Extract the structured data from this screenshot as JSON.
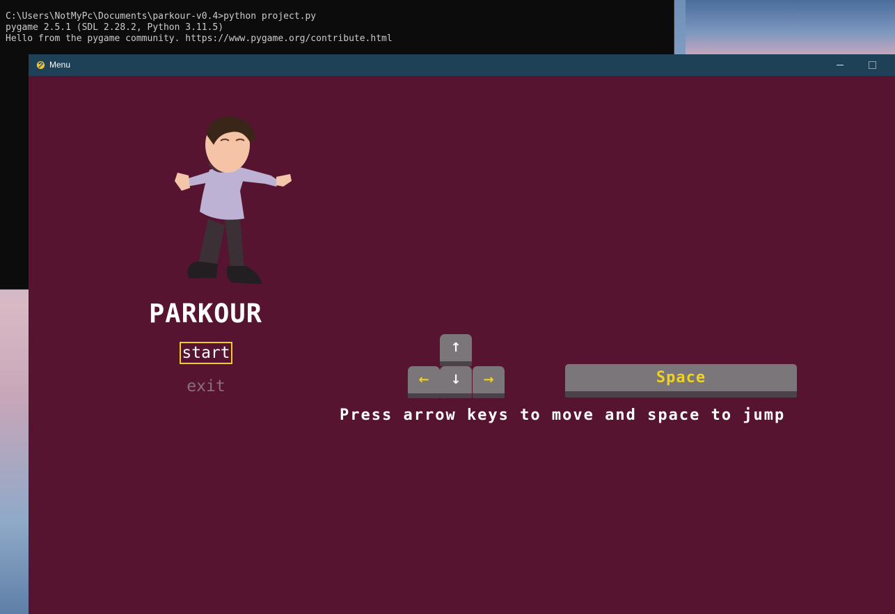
{
  "terminal": {
    "lines": [
      "C:\\Users\\NotMyPc\\Documents\\parkour-v0.4>python project.py",
      "pygame 2.5.1 (SDL 2.28.2, Python 3.11.5)",
      "Hello from the pygame community. https://www.pygame.org/contribute.html"
    ]
  },
  "window": {
    "title": "Menu",
    "icon": "pygame-snake-icon",
    "colors": {
      "titlebar": "#1f4158",
      "background": "#561431"
    }
  },
  "menu": {
    "game_title": "PARKOUR",
    "start_label": "start",
    "exit_label": "exit",
    "selected_item": "start",
    "highlight_color": "#f0cf1f"
  },
  "controls": {
    "keys": {
      "up": "↑",
      "left": "←",
      "down": "↓",
      "right": "→",
      "space": "Space"
    },
    "instructions": "Press arrow keys to move and space to jump",
    "key_accent_color": "#f0d21f"
  }
}
